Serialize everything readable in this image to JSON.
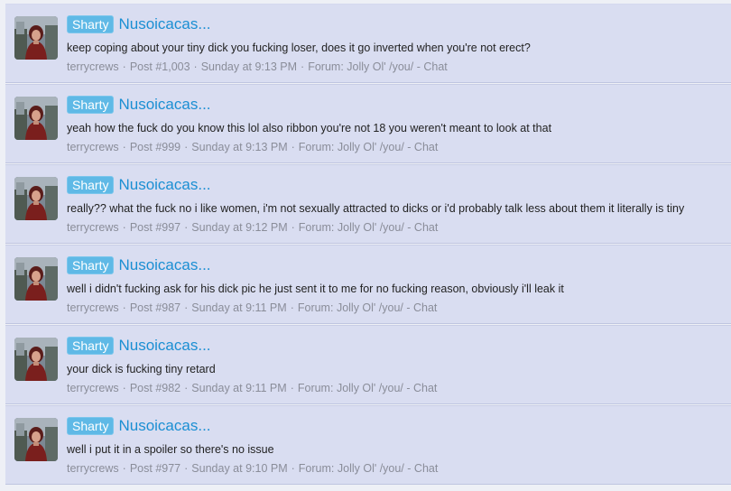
{
  "results": [
    {
      "prefix": "Sharty",
      "title": "Nusoicacas...",
      "snippet": "keep coping about your tiny dick you fucking loser, does it go inverted when you're not erect?",
      "author": "terrycrews",
      "post": "Post #1,003",
      "date": "Sunday at 9:13 PM",
      "forum_label": "Forum:",
      "forum": "Jolly Ol' /you/ - Chat"
    },
    {
      "prefix": "Sharty",
      "title": "Nusoicacas...",
      "snippet": "yeah how the fuck do you know this lol also ribbon you're not 18 you weren't meant to look at that",
      "author": "terrycrews",
      "post": "Post #999",
      "date": "Sunday at 9:13 PM",
      "forum_label": "Forum:",
      "forum": "Jolly Ol' /you/ - Chat"
    },
    {
      "prefix": "Sharty",
      "title": "Nusoicacas...",
      "snippet": "really?? what the fuck no i like women, i'm not sexually attracted to dicks or i'd probably talk less about them it literally is tiny",
      "author": "terrycrews",
      "post": "Post #997",
      "date": "Sunday at 9:12 PM",
      "forum_label": "Forum:",
      "forum": "Jolly Ol' /you/ - Chat"
    },
    {
      "prefix": "Sharty",
      "title": "Nusoicacas...",
      "snippet": "well i didn't fucking ask for his dick pic he just sent it to me for no fucking reason, obviously i'll leak it",
      "author": "terrycrews",
      "post": "Post #987",
      "date": "Sunday at 9:11 PM",
      "forum_label": "Forum:",
      "forum": "Jolly Ol' /you/ - Chat"
    },
    {
      "prefix": "Sharty",
      "title": "Nusoicacas...",
      "snippet": "your dick is fucking tiny retard",
      "author": "terrycrews",
      "post": "Post #982",
      "date": "Sunday at 9:11 PM",
      "forum_label": "Forum:",
      "forum": "Jolly Ol' /you/ - Chat"
    },
    {
      "prefix": "Sharty",
      "title": "Nusoicacas...",
      "snippet": "well i put it in a spoiler so there's no issue",
      "author": "terrycrews",
      "post": "Post #977",
      "date": "Sunday at 9:10 PM",
      "forum_label": "Forum:",
      "forum": "Jolly Ol' /you/ - Chat"
    }
  ],
  "colors": {
    "row_bg": "#d9ddf1",
    "prefix_bg": "#5fb9e6",
    "title": "#1b8fd3",
    "meta": "#8a8d99"
  }
}
